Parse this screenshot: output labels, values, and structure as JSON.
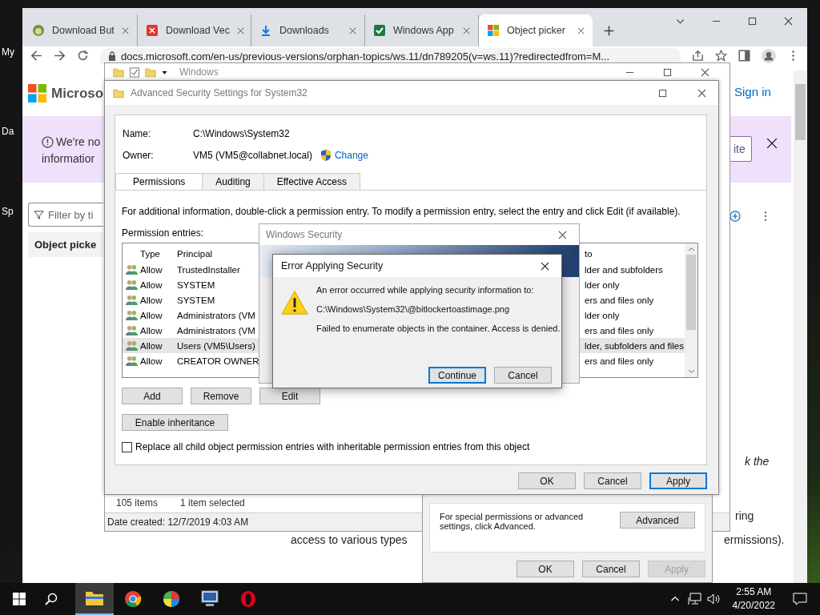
{
  "desktop": {
    "icon_labels": [
      "My",
      "Da",
      "Sp"
    ]
  },
  "browser": {
    "tabs": [
      {
        "label": "Download But",
        "kind": "avatar",
        "selected": false
      },
      {
        "label": "Download Vec",
        "kind": "pdf",
        "selected": false
      },
      {
        "label": "Downloads",
        "kind": "download",
        "selected": false
      },
      {
        "label": "Windows App",
        "kind": "sheet",
        "selected": false
      },
      {
        "label": "Object picker",
        "kind": "grid",
        "selected": true
      }
    ],
    "address": "docs.microsoft.com/en-us/previous-versions/orphan-topics/ws.11/dn789205(v=ws.11)?redirectedfrom=M...",
    "page": {
      "logo": "Microso",
      "sign_in": "Sign in",
      "banner_line_1": "We're no",
      "banner_line_2": "informatior",
      "banner_button": "ite",
      "filter_placeholder": "Filter by ti",
      "nav_item": "Object picke",
      "fragments": [
        {
          "text": "k the",
          "italic": true
        },
        {
          "text": "ring",
          "italic": false
        },
        {
          "text": "access to various types",
          "italic": false
        },
        {
          "text": "ermissions).",
          "italic": false
        }
      ]
    }
  },
  "explorer": {
    "title": "Windows",
    "item_count": "105 items",
    "selection": "1 item selected",
    "date_created": "Date created: 12/7/2019 4:03 AM"
  },
  "properties": {
    "note": "For special permissions or advanced settings, click Advanced.",
    "advanced_button": "Advanced",
    "buttons": [
      {
        "label": "OK",
        "disabled": false
      },
      {
        "label": "Cancel",
        "disabled": false
      },
      {
        "label": "Apply",
        "disabled": true
      }
    ]
  },
  "advanced": {
    "title": "Advanced Security Settings for System32",
    "name_label": "Name:",
    "name_value": "C:\\Windows\\System32",
    "owner_label": "Owner:",
    "owner_value": "VM5 (VM5@collabnet.local)",
    "change_link": "Change",
    "tabs": [
      {
        "label": "Permissions",
        "selected": true
      },
      {
        "label": "Auditing",
        "selected": false
      },
      {
        "label": "Effective Access",
        "selected": false
      }
    ],
    "info": "For additional information, double-click a permission entry. To modify a permission entry, select the entry and click Edit (if available).",
    "entries_label": "Permission entries:",
    "columns": {
      "type": "Type",
      "principal": "Principal",
      "column_3": "to"
    },
    "rows": [
      {
        "type": "Allow",
        "principal": "TrustedInstaller",
        "column_3": "lder and subfolders",
        "selected": false
      },
      {
        "type": "Allow",
        "principal": "SYSTEM",
        "column_3": "lder only",
        "selected": false
      },
      {
        "type": "Allow",
        "principal": "SYSTEM",
        "column_3": "ers and files only",
        "selected": false
      },
      {
        "type": "Allow",
        "principal": "Administrators (VM",
        "column_3": "lder only",
        "selected": false
      },
      {
        "type": "Allow",
        "principal": "Administrators (VM",
        "column_3": "ers and files only",
        "selected": false
      },
      {
        "type": "Allow",
        "principal": "Users (VM5\\Users)",
        "column_3": "lder, subfolders and files",
        "selected": true
      },
      {
        "type": "Allow",
        "principal": "CREATOR OWNER",
        "column_3": "ers and files only",
        "selected": false
      }
    ],
    "entry_buttons": [
      "Add",
      "Remove",
      "Edit"
    ],
    "enable_inheritance": "Enable inheritance",
    "replace_option": {
      "label": "Replace all child object permission entries with inheritable permission entries from this object",
      "checked": false
    },
    "buttons": [
      {
        "label": "OK",
        "default": false
      },
      {
        "label": "Cancel",
        "default": false
      },
      {
        "label": "Apply",
        "default": true
      }
    ]
  },
  "windows_security": {
    "title": "Windows Security"
  },
  "error": {
    "title": "Error Applying Security",
    "message": "An error occurred while applying security information to:",
    "path": "C:\\Windows\\System32\\@bitlockertoastimage.png",
    "detail": "Failed to enumerate objects in the container. Access is denied.",
    "buttons": [
      {
        "label": "Continue",
        "default": true
      },
      {
        "label": "Cancel",
        "default": false
      }
    ]
  },
  "taskbar": {
    "apps": [
      {
        "kind": "explorer",
        "active": true
      },
      {
        "kind": "chrome",
        "active": false
      },
      {
        "kind": "pie",
        "active": false
      },
      {
        "kind": "monitor",
        "active": false
      },
      {
        "kind": "opera",
        "active": false
      }
    ],
    "time": "2:55 AM",
    "date": "4/20/2022"
  }
}
